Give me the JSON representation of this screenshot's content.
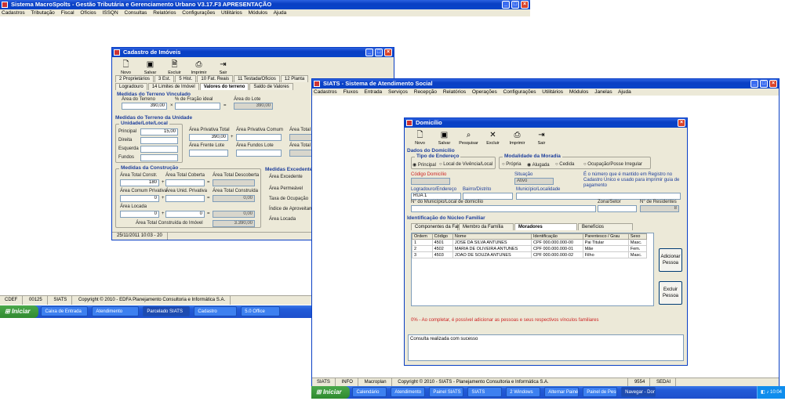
{
  "main_window": {
    "title": "Sistema MacroSpolts - Gestão Tributária e Gerenciamento Urbano V3.17.F3 APRESENTAÇÃO",
    "menu": [
      "Cadastros",
      "Tributação",
      "Fiscal",
      "Ofícios",
      "ISSQN",
      "Consultas",
      "Relatórios",
      "Configurações",
      "Utilitários",
      "Módulos",
      "Ajuda"
    ]
  },
  "imoveis": {
    "title": "Cadastro de Imóveis",
    "toolbar": [
      "Novo",
      "Salvar",
      "Excluir",
      "Imprimir",
      "Sair"
    ],
    "tabs": [
      "2 Proprietários",
      "3 Est.",
      "5 Hist.",
      "10 Fat. Reais",
      "11 Testada/Oficios",
      "12 Planta",
      "Reservas/Itens",
      "Logradouro",
      "14 Limites de Imóvel",
      "Valores do terreno",
      "Saldo de Valores"
    ],
    "grp_terreno_vinculado": "Medidas do Terreno Vinculado",
    "lbl_area_terreno": "Área do Terreno",
    "lbl_perc_fracao": "% de Fração ideal",
    "lbl_area_unid": "Área do Lote",
    "val_area_terreno": "390,00",
    "val_area_unid": "390,00",
    "grp_terreno_unidade": "Medidas do Terreno da Unidade",
    "grp_unidade": "Unidade/Lote/Local",
    "lbl_principal": "Principal",
    "lbl_direita": "Direita",
    "lbl_esquerda": "Esquerda",
    "lbl_fundos": "Fundos",
    "val_principal": "15,00",
    "lbl_area_privativa": "Área Privativa Total",
    "lbl_area_comum": "Área Privativa Comum",
    "lbl_area_total": "Área Total",
    "lbl_area_frente": "Área Frente Lote",
    "lbl_area_fundo": "Área Fundos Lote",
    "lbl_area_outros": "Área Total",
    "val_area_privativa": "390,00",
    "grp_construcao": "Medidas da Construção",
    "grp_excedentes": "Medidas Excedentes",
    "lbl_area_const": "Área Total Constr.",
    "lbl_area_coberta": "Área Total Coberta",
    "lbl_area_cobertura": "Área Total Descoberta",
    "lbl_area_comum2": "Área Comum Privativa",
    "lbl_area_unid2": "Área Unid. Privativa",
    "lbl_area_total2": "Área Total Construída",
    "lbl_area_excedente": "Área Excedente",
    "lbl_area_perm": "Área Permeável",
    "lbl_taxa_ocup": "Taxa de Ocupação",
    "lbl_indice": "Índice de Aproveitamento",
    "lbl_area_locada": "Área Locada",
    "lbl_total_construida": "Área Total Construída do Imóvel",
    "val_const1": "180",
    "val_const2": "0",
    "val_const3": "0,00",
    "val_const4": "0",
    "val_const5": "0",
    "val_const6": "0,00",
    "val_total": "3.390,00",
    "val_excedente": "0,00",
    "status": "25/11/2011 10:03 - 20"
  },
  "siats": {
    "title": "SIATS - Sistema de Atendimento Social",
    "menu": [
      "Cadastros",
      "Fluxos",
      "Entrada",
      "Serviços",
      "Recepção",
      "Relatórios",
      "Operações",
      "Configurações",
      "Utilitários",
      "Módulos",
      "Janelas",
      "Ajuda"
    ],
    "status": [
      "SIATS",
      "INFO",
      "Macroplan",
      "Copyright © 2010 - SIATS - Planejamento Consultoria e Informática S.A."
    ]
  },
  "domicilio": {
    "title": "Domicílio",
    "toolbar": [
      "Novo",
      "Salvar",
      "Pesquisar",
      "Excluir",
      "Imprimir",
      "Sair"
    ],
    "section_dados": "Dados do Domicílio",
    "grp_tipo": "Tipo de Endereço",
    "radio_tipo": [
      "Principal",
      "Local de Vivência/Local"
    ],
    "grp_modalidade": "Modalidade da Moradia",
    "radio_modalidade": [
      "Própria",
      "Alugada",
      "Cedida",
      "Ocupação/Posse Irregular"
    ],
    "lbl_codigo": "Código Domicílio",
    "lbl_situacao": "Situação",
    "val_situacao": "Ativo",
    "note": "É o número que é mantido em Registro no Cadastro Único e usado para imprimir guia de pagamento",
    "lbl_logradouro": "Logradouro/Endereço",
    "lbl_bairro": "Bairro/Distrito",
    "lbl_municipio": "Município/Localidade",
    "val_logradouro": "RUA 1",
    "lbl_numero": "N° do Município/Local de domicílio",
    "lbl_zona": "Zona/Setor",
    "lbl_num": "N° de Residentes",
    "val_num": "8",
    "section_pessoas": "Identificação do Núcleo Familiar",
    "tabs": [
      "Componentes da Família",
      "Membro da Família",
      "Moradores",
      "Benefícios"
    ],
    "grid_headers": [
      "Ordem",
      "Código",
      "Nome",
      "Identificação",
      "Parentesco / Grau",
      "Sexo",
      "Nasc."
    ],
    "grid_rows": [
      [
        "1",
        "4501",
        "JOSE DA SILVA ANTUNES",
        "CPF 000.000.000-00",
        "Pai Titular",
        "Masc.",
        "04/10"
      ],
      [
        "2",
        "4502",
        "MARIA DE OLIVEIRA ANTUNES",
        "CPF 000.000.000-01",
        "Mãe",
        "Fem.",
        "11/05"
      ],
      [
        "3",
        "4503",
        "JOAO DE SOUZA ANTUNES",
        "CPF 000.000.000-02",
        "Filho",
        "Masc.",
        "02/02"
      ]
    ],
    "btn_add": "Adicionar Pessoa",
    "btn_remove": "Excluir Pessoa",
    "warning": "0% - Ao completar, é possível adicionar as pessoas e seus respectivos vínculos familiares",
    "status_bar": "Consulta realizada com sucesso"
  },
  "bottom_status": {
    "siats": [
      "CDEF",
      "00125",
      "SIATS",
      "Copyright © 2010 - EDFA Planejamento Consultoria e Informática S.A."
    ],
    "right": [
      "9554",
      "SEDAI"
    ]
  },
  "taskbar_left": {
    "start": "Iniciar",
    "tasks": [
      "Caixa de Entrada",
      "Atendimento",
      "Parcelado SIATS",
      "Cadastro",
      "5.0 Office"
    ]
  },
  "taskbar_right": {
    "start": "Iniciar",
    "tasks": [
      "Calendário",
      "Atendimento",
      "Painel SIATS",
      "SIATS",
      "2 Windows",
      "Alternar Painéis",
      "Painel de Pessoas",
      "Navegar - Dom",
      "Comando"
    ],
    "clock": "10:04"
  }
}
